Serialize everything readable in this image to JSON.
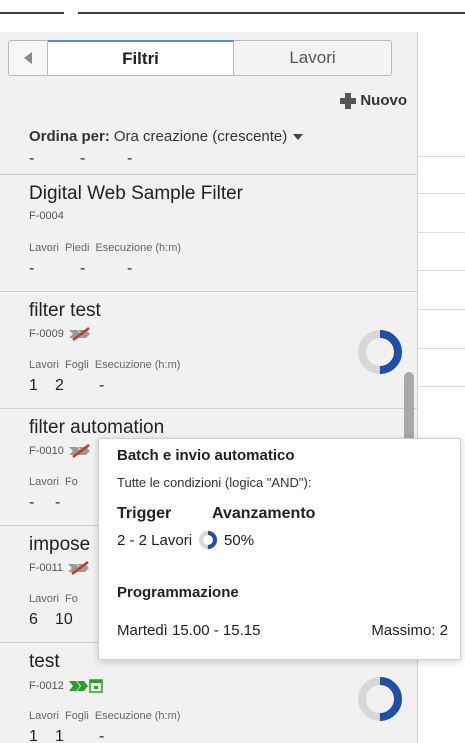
{
  "tabs": {
    "filters": "Filtri",
    "jobs": "Lavori"
  },
  "toolbar": {
    "new_label": "Nuovo"
  },
  "sort": {
    "label": "Ordina per:",
    "value": "Ora creazione (crescente)"
  },
  "partial_row": {
    "values": [
      "-",
      "-",
      "-"
    ]
  },
  "cards": [
    {
      "title": "Digital Web Sample Filter",
      "id": "F-0004",
      "headers": [
        "Lavori",
        "Piedi",
        "Esecuzione (h:m)"
      ],
      "values": [
        "-",
        "-",
        "-"
      ],
      "icon": "none",
      "progress": null
    },
    {
      "title": "filter test",
      "id": "F-0009",
      "headers": [
        "Lavori",
        "Fogli",
        "Esecuzione (h:m)"
      ],
      "values": [
        "1",
        "2",
        "-"
      ],
      "icon": "disabled-arrows-icon",
      "progress": 0.5
    },
    {
      "title": "filter automation",
      "id": "F-0010",
      "headers": [
        "Lavori",
        "Fo"
      ],
      "values": [
        "-",
        "-"
      ],
      "icon": "disabled-arrows-icon",
      "progress": null
    },
    {
      "title": "impose",
      "id": "F-0011",
      "headers": [
        "Lavori",
        "Fo"
      ],
      "values": [
        "6",
        "10"
      ],
      "icon": "disabled-arrows-icon",
      "progress": null
    },
    {
      "title": "test",
      "id": "F-0012",
      "headers": [
        "Lavori",
        "Fogli",
        "Esecuzione (h:m)"
      ],
      "values": [
        "1",
        "1",
        "-"
      ],
      "icon": "enabled-batch-icon",
      "progress": 0.5
    }
  ],
  "tooltip": {
    "title": "Batch e invio automatico",
    "subtitle": "Tutte le condizioni (logica \"AND\"):",
    "trigger_label": "Trigger",
    "progress_label": "Avanzamento",
    "trigger_value": "2 - 2 Lavori",
    "progress_value": "50%",
    "progress_fraction": 0.5,
    "schedule_label": "Programmazione",
    "schedule_value": "Martedì 15.00 - 15.15",
    "max_value": "Massimo: 2"
  },
  "colors": {
    "progress": "#1f4fa8",
    "track": "#d7d7d7",
    "disabled": "#c0392b",
    "enabled": "#2a9d2a",
    "accent": "#4a90d9"
  }
}
